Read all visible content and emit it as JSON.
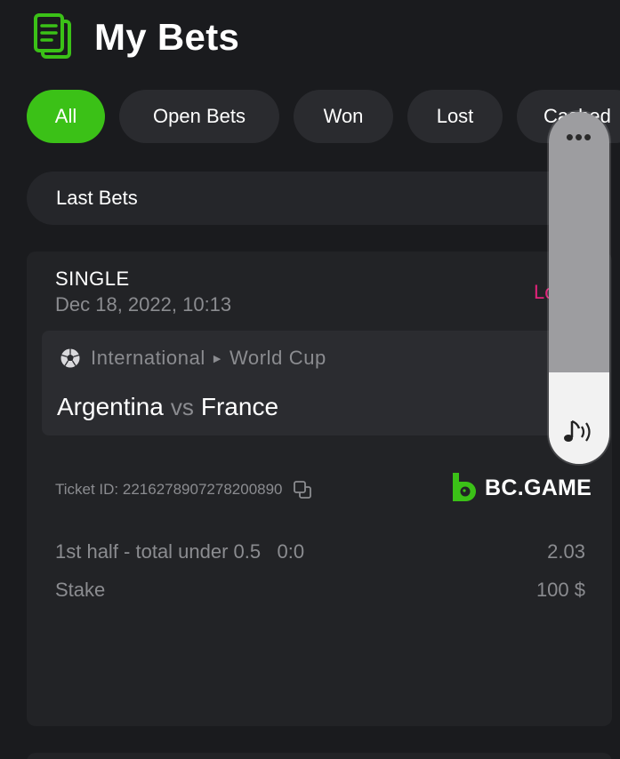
{
  "header": {
    "title": "My Bets",
    "icon": "bet-slip-icon"
  },
  "filters": [
    {
      "label": "All",
      "active": true
    },
    {
      "label": "Open Bets",
      "active": false
    },
    {
      "label": "Won",
      "active": false
    },
    {
      "label": "Lost",
      "active": false
    },
    {
      "label": "Cashed",
      "active": false
    }
  ],
  "last_bets": {
    "label": "Last Bets"
  },
  "bet": {
    "type": "SINGLE",
    "date": "Dec 18, 2022, 10:13",
    "status": "Lost",
    "league": {
      "country": "International",
      "tournament": "World Cup",
      "icon": "soccer-ball-icon"
    },
    "teams": {
      "home": "Argentina",
      "vs": "vs",
      "away": "France"
    },
    "ticket_id": "Ticket ID: 2216278907278200890",
    "brand": "BC.GAME",
    "selection": {
      "label": "1st half - total under 0.5   0:0",
      "odds": "2.03"
    },
    "stake": {
      "label": "Stake",
      "value": "100 $"
    }
  },
  "volume_overlay": {
    "more": "•••",
    "level": 0.26,
    "icon": "music-volume-icon"
  },
  "colors": {
    "accent": "#3bc117",
    "lost": "#e2237a",
    "muted": "#8b8c90"
  }
}
